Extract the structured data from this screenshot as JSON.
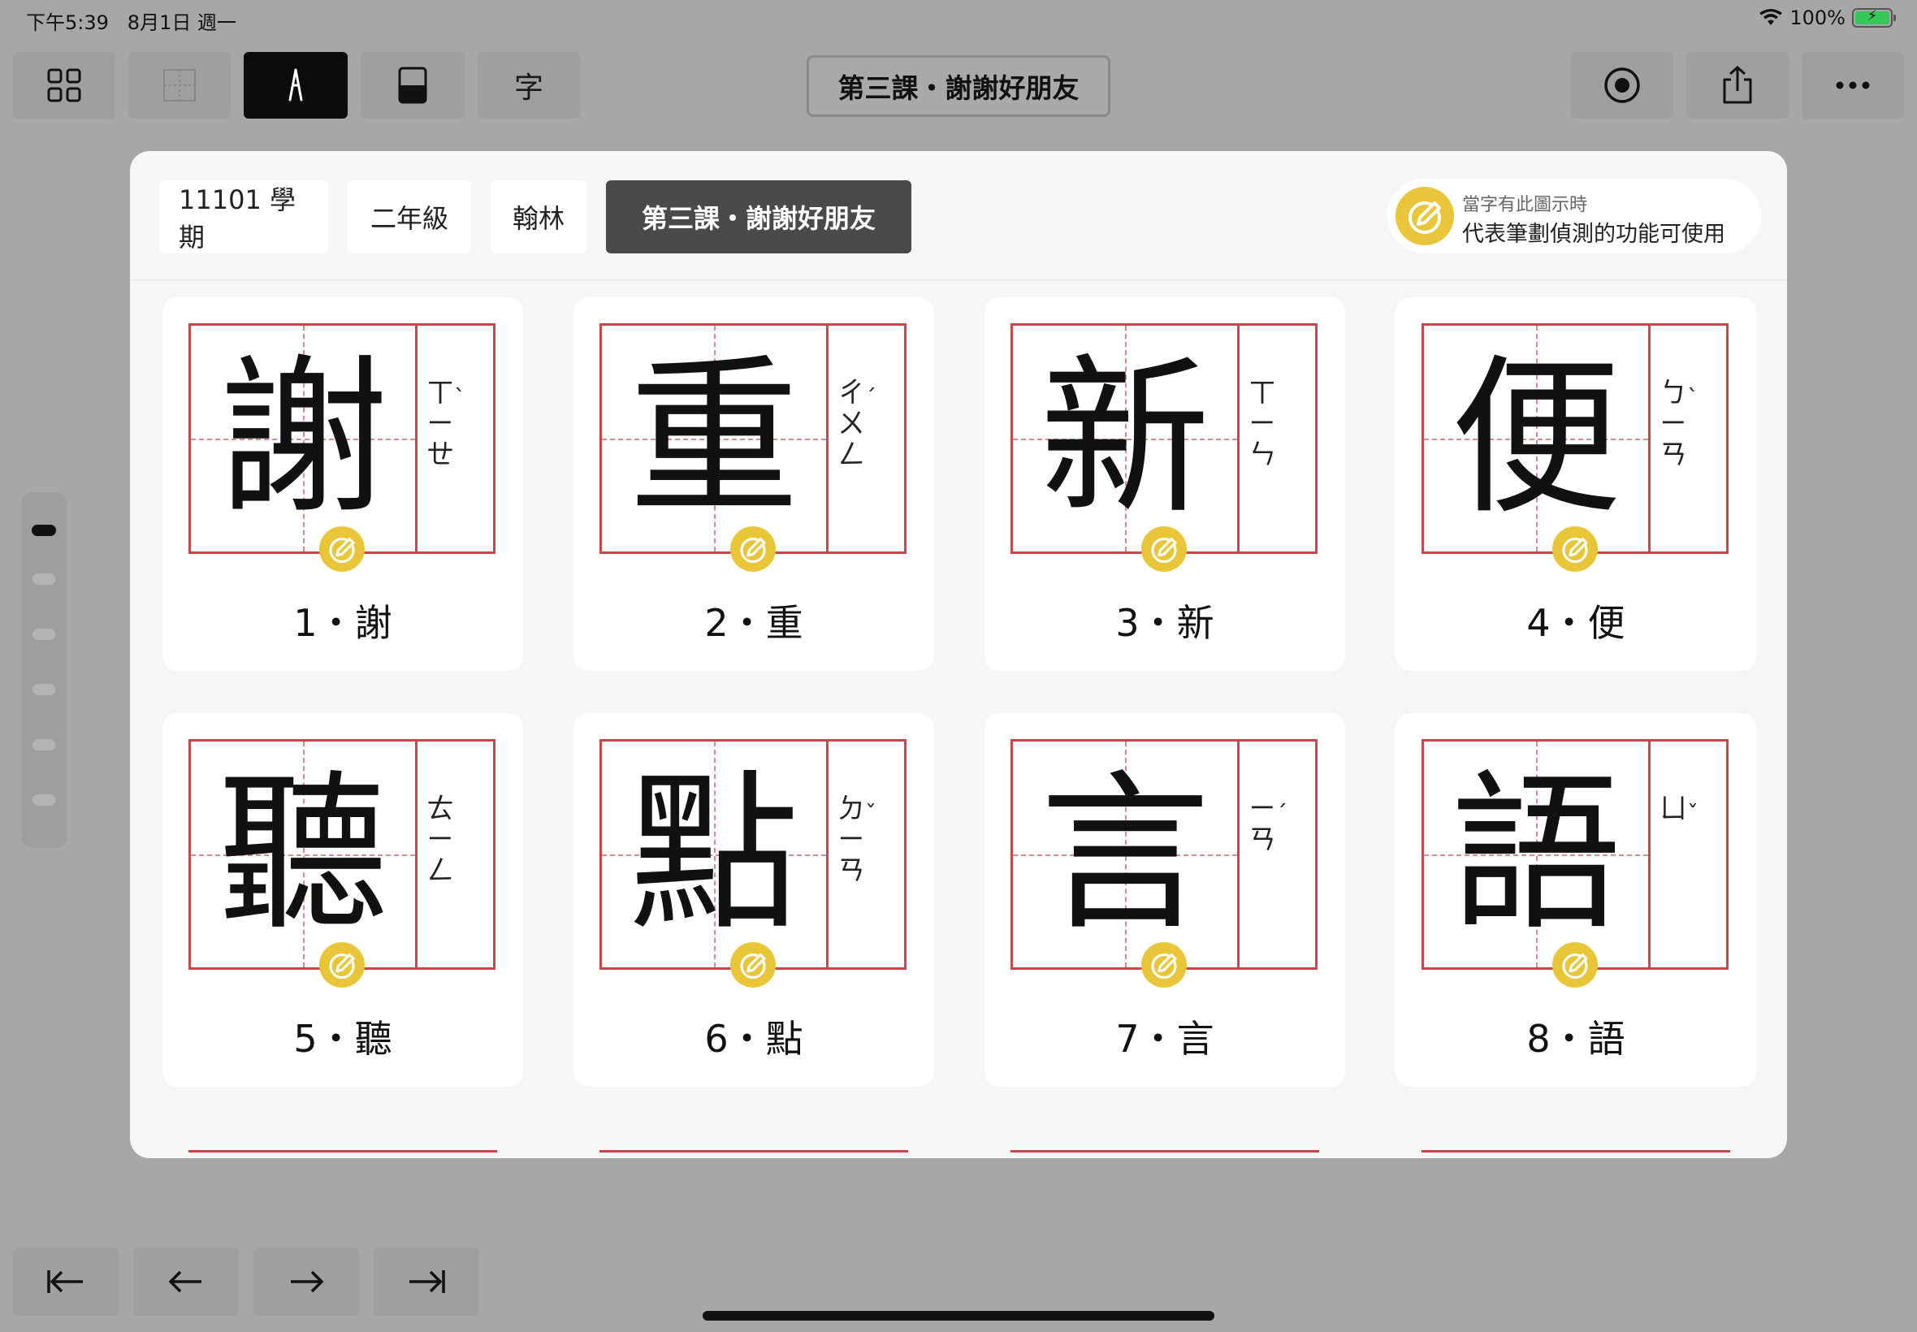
{
  "status": {
    "time": "下午5:39",
    "date": "8月1日 週一",
    "battery": "100%"
  },
  "toolbar": {
    "char_tool_label": "字",
    "title": "第三課・謝謝好朋友"
  },
  "filters": [
    {
      "label": "11101 學期"
    },
    {
      "label": "二年級"
    },
    {
      "label": "翰林"
    },
    {
      "label": "第三課・謝謝好朋友",
      "selected": true
    }
  ],
  "hint": {
    "line1": "當字有此圖示時",
    "line2": "代表筆劃偵測的功能可使用"
  },
  "cards": [
    {
      "hanzi": "謝",
      "bopomofo": "ㄒ\nㄧ\nㄝ",
      "tone": "ˋ",
      "label": "1・謝"
    },
    {
      "hanzi": "重",
      "bopomofo": "ㄔ\nㄨ\nㄥ",
      "tone": "ˊ",
      "label": "2・重"
    },
    {
      "hanzi": "新",
      "bopomofo": "ㄒ\nㄧ\nㄣ",
      "tone": "",
      "label": "3・新"
    },
    {
      "hanzi": "便",
      "bopomofo": "ㄅ\nㄧ\nㄢ",
      "tone": "ˋ",
      "label": "4・便"
    },
    {
      "hanzi": "聽",
      "bopomofo": "ㄊ\nㄧ\nㄥ",
      "tone": "",
      "label": "5・聽"
    },
    {
      "hanzi": "點",
      "bopomofo": "ㄉ\nㄧ\nㄢ",
      "tone": "ˇ",
      "label": "6・點"
    },
    {
      "hanzi": "言",
      "bopomofo": "ㄧ\nㄢ",
      "tone": "ˊ",
      "label": "7・言"
    },
    {
      "hanzi": "語",
      "bopomofo": "ㄩ",
      "tone": "ˇ",
      "label": "8・語"
    }
  ],
  "colors": {
    "grid_red": "#c8474b",
    "badge_yellow": "#e9c53a",
    "selected_chip": "#4a4a4a"
  }
}
